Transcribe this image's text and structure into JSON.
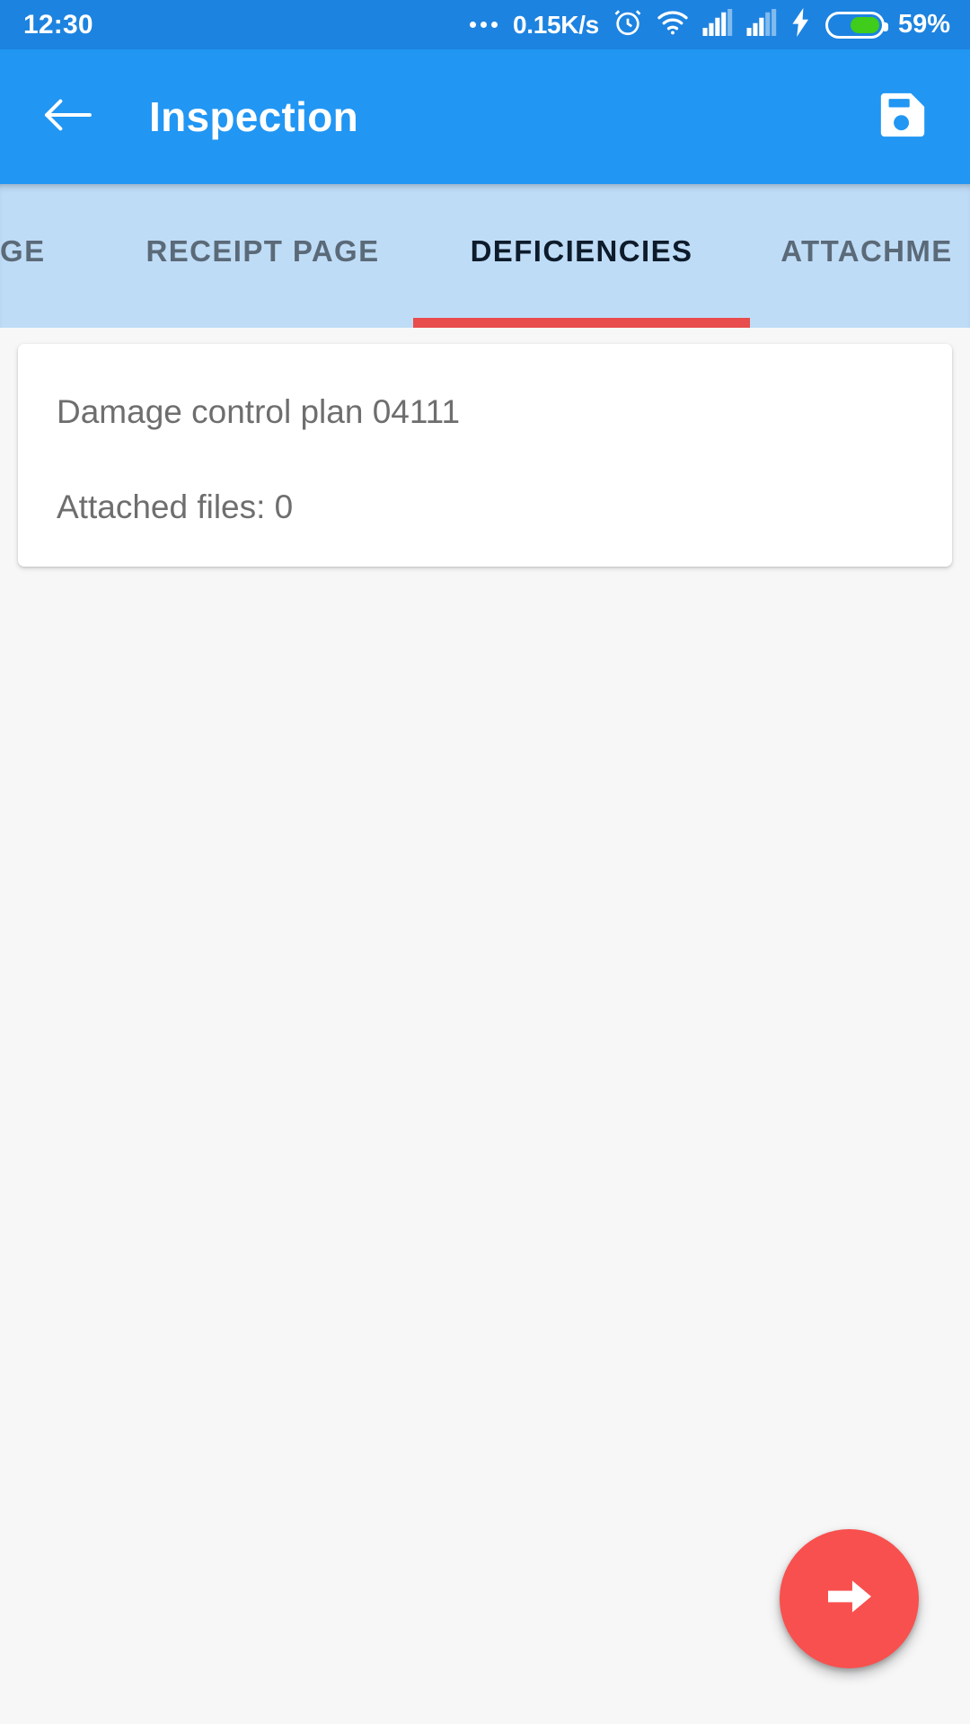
{
  "status_bar": {
    "time": "12:30",
    "network_speed": "0.15K/s",
    "battery_percent": "59%",
    "battery_level": 59,
    "icons": [
      "more-dots-icon",
      "alarm-clock-icon",
      "wifi-icon",
      "signal-sim1-icon",
      "signal-sim2-icon",
      "charging-bolt-icon",
      "battery-icon"
    ],
    "background_color": "#1d83e0"
  },
  "app_bar": {
    "title": "Inspection",
    "back_icon": "arrow-left-icon",
    "save_icon": "save-floppy-icon",
    "background_color": "#2196f3"
  },
  "tabs": {
    "items": [
      {
        "label": "GE",
        "active": false,
        "truncated_start": true
      },
      {
        "label": "RECEIPT PAGE",
        "active": false
      },
      {
        "label": "DEFICIENCIES",
        "active": true
      },
      {
        "label": "ATTACHME",
        "active": false,
        "truncated_end": true
      }
    ],
    "indicator_color": "#e84c4c",
    "background_color": "#bfdcf7",
    "active_text_color": "#0d1b2a",
    "inactive_text_color": "#5b6a78"
  },
  "content": {
    "card": {
      "title": "Damage control plan 04111",
      "attached_files": "Attached files: 0"
    }
  },
  "fab": {
    "icon": "arrow-right-icon",
    "color": "#f8504e"
  }
}
